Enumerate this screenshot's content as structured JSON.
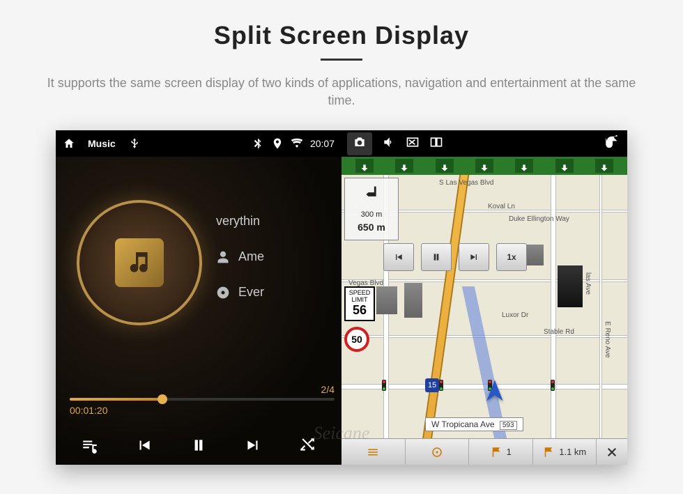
{
  "header": {
    "title": "Split Screen Display",
    "subtitle": "It supports the same screen display of two kinds of applications, navigation and entertainment at the same time."
  },
  "status": {
    "app_label": "Music",
    "clock": "20:07"
  },
  "music": {
    "track_title": "verythin",
    "artist": "Ame",
    "album": "Ever",
    "track_index": "2/4",
    "elapsed": "00:01:20"
  },
  "nav": {
    "turn_distance_small": "300 m",
    "turn_distance_big": "650 m",
    "speed_limit_label": "SPEED LIMIT",
    "speed_limit_value": "56",
    "speed_sign": "50",
    "playback_rate": "1x",
    "streets": {
      "s_las_vegas": "S Las Vegas Blvd",
      "koval": "Koval Ln",
      "duke": "Duke Ellington Way",
      "vegas_blvd": "Vegas Blvd",
      "luxor": "Luxor Dr",
      "stable": "Stable Rd",
      "reno": "E Reno Ave",
      "tropicana": "W Tropicana Ave",
      "tropicana_num": "593",
      "las_ave": "las Ave"
    },
    "bottom": {
      "flag": "1",
      "dist": "1.1 km"
    },
    "interstate": "15"
  },
  "watermark": "Seicane"
}
